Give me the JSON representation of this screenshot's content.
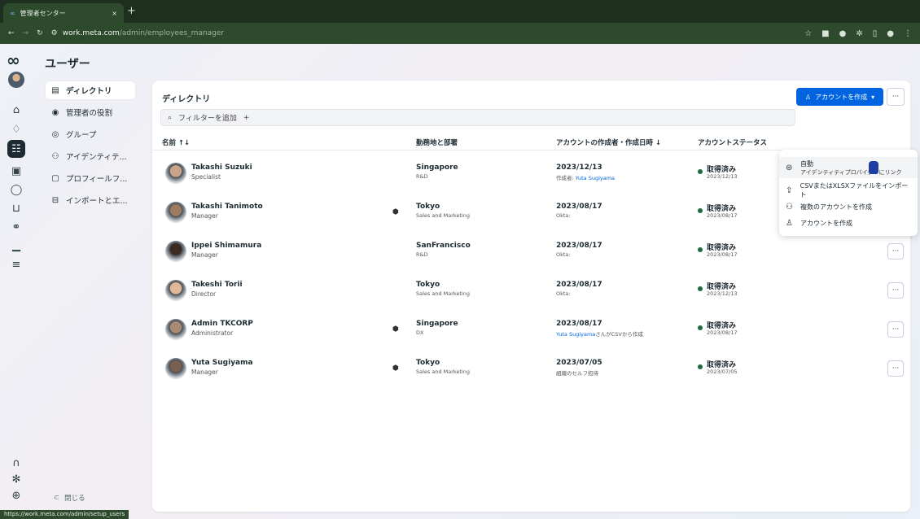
{
  "browser": {
    "tab_title": "管理者センター",
    "tab_close": "×",
    "new_tab": "+",
    "url_host": "work.meta.com",
    "url_path": "/admin/employees_manager",
    "status_url": "https://work.meta.com/admin/setup_users"
  },
  "page": {
    "title": "ユーザー"
  },
  "nav": {
    "items": [
      {
        "label": "ディレクトリ",
        "icon": "directory-icon"
      },
      {
        "label": "管理者の役割",
        "icon": "admin-role-icon"
      },
      {
        "label": "グループ",
        "icon": "group-icon"
      },
      {
        "label": "アイデンティテ...",
        "icon": "identity-icon"
      },
      {
        "label": "プロフィールフ...",
        "icon": "profile-field-icon"
      },
      {
        "label": "インポートとエ...",
        "icon": "import-export-icon"
      }
    ],
    "close_label": "閉じる"
  },
  "directory": {
    "title": "ディレクトリ",
    "create_button": "アカウントを作成",
    "more": "···",
    "filter_label": "フィルターを追加",
    "filter_plus": "+",
    "columns": {
      "name": "名前 ↑↓",
      "location": "勤務地と部署",
      "created": "アカウントの作成者・作成日時 ↓",
      "status": "アカウントステータス"
    },
    "rows": [
      {
        "name": "Takashi Suzuki",
        "role": "Specialist",
        "admin": false,
        "location": "Singapore",
        "dept": "R&D",
        "date": "2023/12/13",
        "by_prefix": "作成者: ",
        "by_link": "Yuta Sugiyama",
        "by_suffix": "",
        "status": "取得済み",
        "status_date": "2023/12/13"
      },
      {
        "name": "Takashi Tanimoto",
        "role": "Manager",
        "admin": true,
        "location": "Tokyo",
        "dept": "Sales and Marketing",
        "date": "2023/08/17",
        "by_prefix": "Okta:",
        "by_link": "",
        "by_suffix": "",
        "status": "取得済み",
        "status_date": "2023/08/17"
      },
      {
        "name": "Ippei Shimamura",
        "role": "Manager",
        "admin": false,
        "location": "SanFrancisco",
        "dept": "R&D",
        "date": "2023/08/17",
        "by_prefix": "Okta:",
        "by_link": "",
        "by_suffix": "",
        "status": "取得済み",
        "status_date": "2023/08/17"
      },
      {
        "name": "Takeshi Torii",
        "role": "Director",
        "admin": false,
        "location": "Tokyo",
        "dept": "Sales and Marketing",
        "date": "2023/08/17",
        "by_prefix": "Okta:",
        "by_link": "",
        "by_suffix": "",
        "status": "取得済み",
        "status_date": "2023/12/13"
      },
      {
        "name": "Admin TKCORP",
        "role": "Administrator",
        "admin": true,
        "location": "Singapore",
        "dept": "DX",
        "date": "2023/08/17",
        "by_prefix": "",
        "by_link": "Yuta Sugiyama",
        "by_suffix": "さんがCSVから作成",
        "status": "取得済み",
        "status_date": "2023/08/17"
      },
      {
        "name": "Yuta Sugiyama",
        "role": "Manager",
        "admin": true,
        "location": "Tokyo",
        "dept": "Sales and Marketing",
        "date": "2023/07/05",
        "by_prefix": "組織のセルフ招待",
        "by_link": "",
        "by_suffix": "",
        "status": "取得済み",
        "status_date": "2023/07/05"
      }
    ]
  },
  "menu": {
    "auto_title": "自動",
    "auto_sub": "アイデンティティプロバイダーにリンク",
    "csv": "CSVまたはXLSXファイルをインポート",
    "multiple": "複数のアカウントを作成",
    "single": "アカウントを作成"
  },
  "colors": {
    "accent": "#0064e0",
    "status_ok": "#1c6b3b",
    "chrome": "#2d4a2d"
  }
}
